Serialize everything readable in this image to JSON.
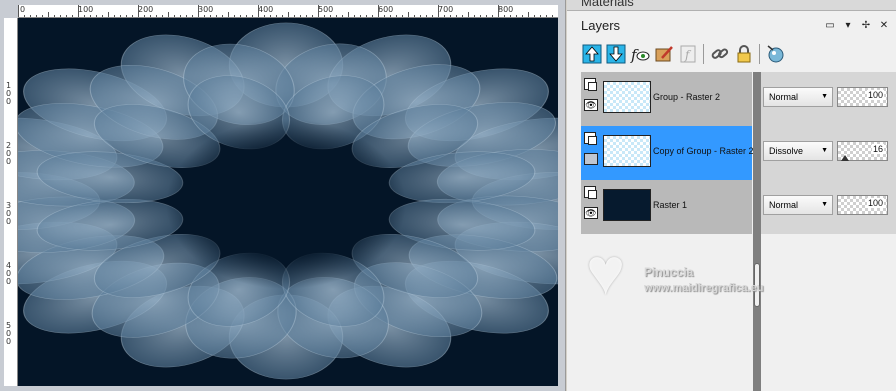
{
  "rulers": {
    "top_labels": [
      "0",
      "100",
      "200",
      "300",
      "400",
      "500",
      "600",
      "700",
      "800"
    ],
    "left_labels": [
      "1\n0\n0",
      "2\n0\n0",
      "3\n0\n0",
      "4\n0\n0",
      "5\n0\n0"
    ]
  },
  "panels": {
    "materials_title": "Materials",
    "layers_title": "Layers"
  },
  "layers": [
    {
      "name": "Group - Raster 2",
      "blend": "Normal",
      "opacity": "100",
      "selected": false,
      "visible": true,
      "thumb": "transparent"
    },
    {
      "name": "Copy of Group - Raster 2",
      "blend": "Dissolve",
      "opacity": "16",
      "selected": true,
      "visible": false,
      "thumb": "transparent"
    },
    {
      "name": "Raster 1",
      "blend": "Normal",
      "opacity": "100",
      "selected": false,
      "visible": true,
      "thumb": "dark"
    }
  ],
  "watermark": {
    "name": "Pinuccia",
    "url": "www.maidiregrafica.eu"
  },
  "colors": {
    "canvas_bg": "#041527",
    "flower": "#7fa0bd",
    "selected_row": "#3399ff"
  }
}
